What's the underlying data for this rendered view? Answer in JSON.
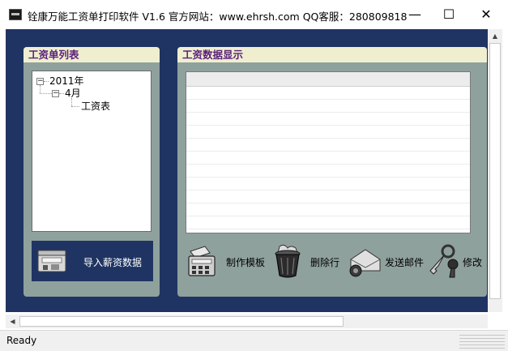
{
  "window": {
    "title": "铨康万能工资单打印软件 V1.6   官方网站：www.ehrsh.com   QQ客服：280809818",
    "minimize_glyph": "—",
    "maximize_glyph": "☐",
    "close_glyph": "✕"
  },
  "left_panel": {
    "title": "工资单列表",
    "tree": {
      "year": "2011年",
      "month": "4月",
      "leaf": "工资表",
      "expander_glyph": "−"
    },
    "import_button": {
      "label": "导入薪资数据",
      "icon": "scanner-import-icon"
    }
  },
  "right_panel": {
    "title": "工资数据显示",
    "toolbar": {
      "make_template": {
        "label": "制作模板",
        "icon": "template-calculator-icon"
      },
      "delete_row": {
        "label": "删除行",
        "icon": "trash-can-icon"
      },
      "send_mail": {
        "label": "发送邮件",
        "icon": "envelope-mail-icon"
      },
      "modify": {
        "label": "修改",
        "icon": "keys-icon"
      }
    }
  },
  "scrollbars": {
    "up_glyph": "▲",
    "left_glyph": "◀"
  },
  "status": {
    "text": "Ready"
  },
  "colors": {
    "client_background": "#1f3462",
    "panel_background": "#8fa19c",
    "panel_header": "#efefd0",
    "panel_title": "#5a1f7a"
  }
}
